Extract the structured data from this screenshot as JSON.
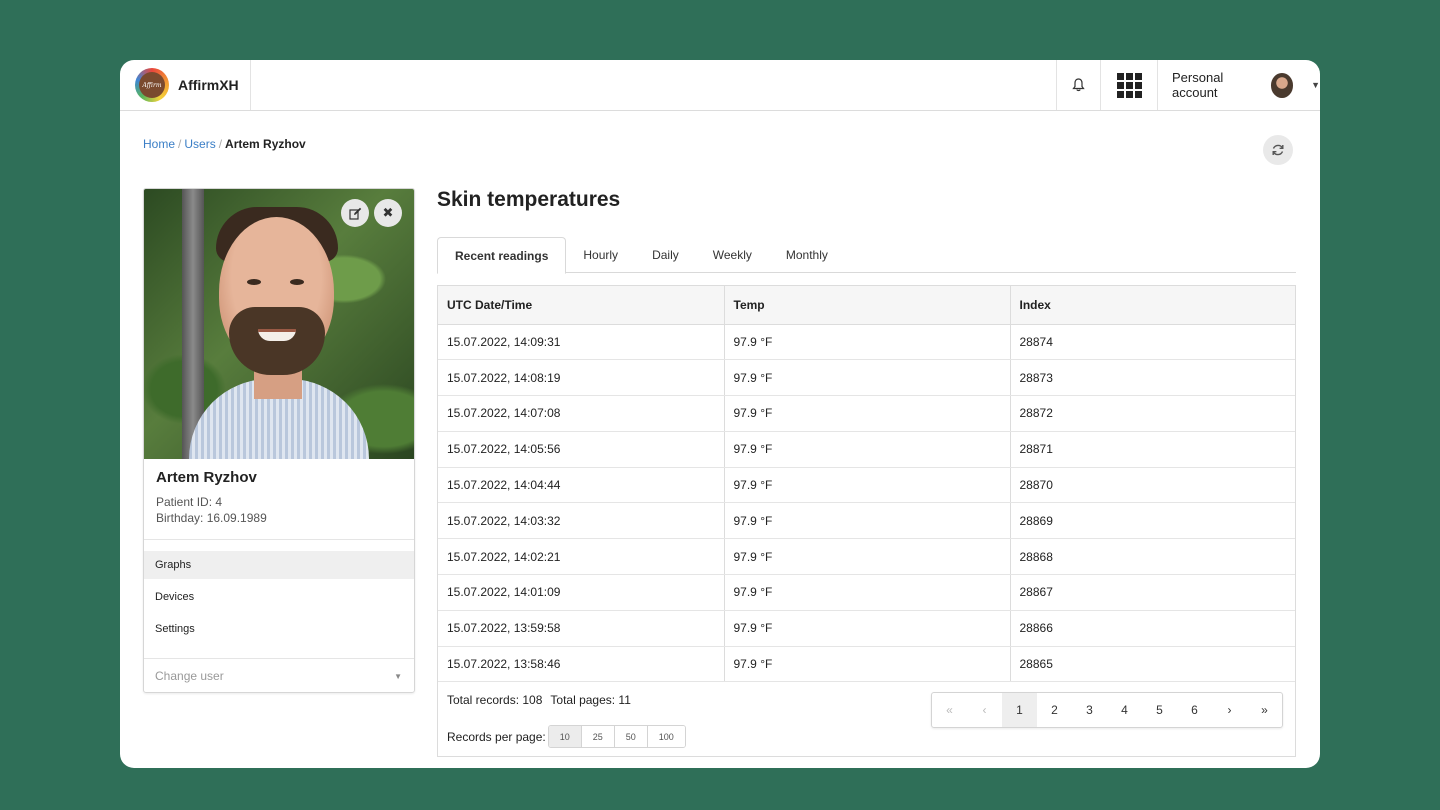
{
  "app": {
    "name": "AffirmXH",
    "logo_text": "Affirm"
  },
  "header": {
    "account_label": "Personal account"
  },
  "breadcrumb": {
    "home": "Home",
    "users": "Users",
    "current": "Artem Ryzhov"
  },
  "profile": {
    "name": "Artem Ryzhov",
    "patient_id": "Patient ID: 4",
    "birthday": "Birthday: 16.09.1989",
    "menu": [
      "Graphs",
      "Devices",
      "Settings"
    ],
    "change_user_placeholder": "Change user"
  },
  "main": {
    "title": "Skin temperatures",
    "tabs": [
      "Recent readings",
      "Hourly",
      "Daily",
      "Weekly",
      "Monthly"
    ],
    "active_tab": 0
  },
  "table": {
    "headers": [
      "UTC Date/Time",
      "Temp",
      "Index"
    ],
    "rows": [
      [
        "15.07.2022, 14:09:31",
        "97.9 °F",
        "28874"
      ],
      [
        "15.07.2022, 14:08:19",
        "97.9 °F",
        "28873"
      ],
      [
        "15.07.2022, 14:07:08",
        "97.9 °F",
        "28872"
      ],
      [
        "15.07.2022, 14:05:56",
        "97.9 °F",
        "28871"
      ],
      [
        "15.07.2022, 14:04:44",
        "97.9 °F",
        "28870"
      ],
      [
        "15.07.2022, 14:03:32",
        "97.9 °F",
        "28869"
      ],
      [
        "15.07.2022, 14:02:21",
        "97.9 °F",
        "28868"
      ],
      [
        "15.07.2022, 14:01:09",
        "97.9 °F",
        "28867"
      ],
      [
        "15.07.2022, 13:59:58",
        "97.9 °F",
        "28866"
      ],
      [
        "15.07.2022, 13:58:46",
        "97.9 °F",
        "28865"
      ]
    ]
  },
  "footer": {
    "total_records": "Total records: 108",
    "total_pages": "Total pages: 11",
    "records_per_page_label": "Records per page:",
    "records_per_page_options": [
      "10",
      "25",
      "50",
      "100"
    ],
    "records_per_page_selected": "10"
  },
  "pagination": {
    "first": "«",
    "prev": "‹",
    "pages": [
      "1",
      "2",
      "3",
      "4",
      "5",
      "6"
    ],
    "current": "1",
    "next": "›",
    "last": "»"
  },
  "colors": {
    "background": "#2f6f58",
    "link": "#3a7ec6"
  }
}
